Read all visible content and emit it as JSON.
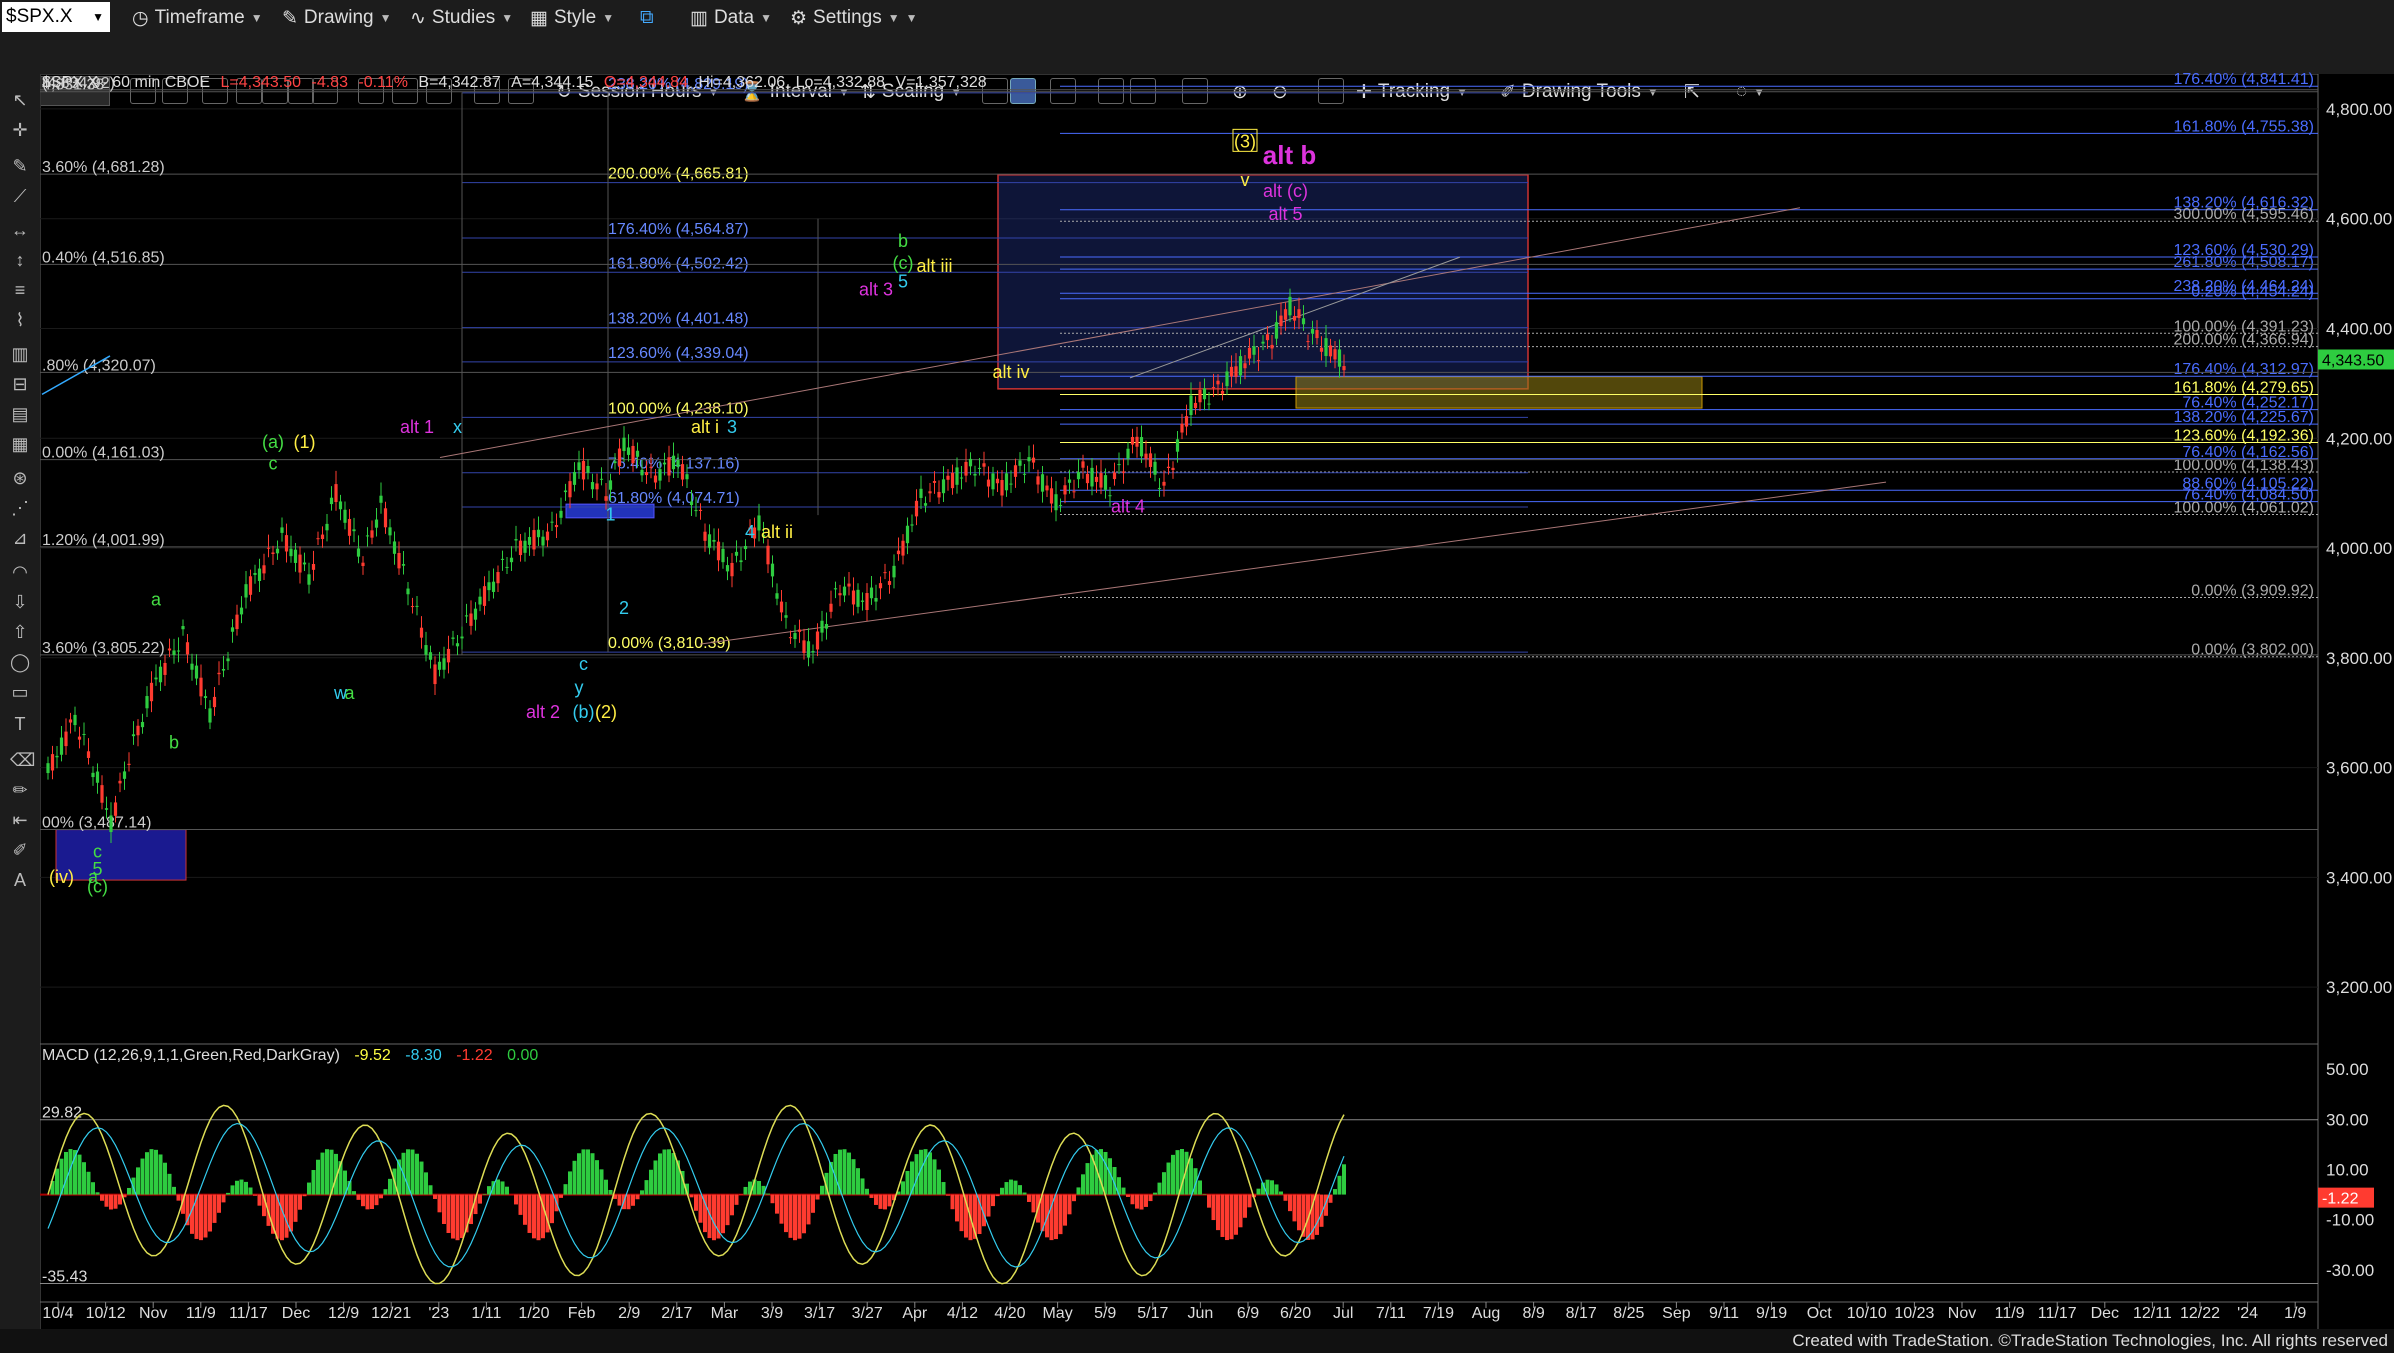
{
  "toolbar": {
    "symbol": "$SPX.X",
    "timeframe": "Timeframe",
    "drawing": "Drawing",
    "studies": "Studies",
    "style": "Style",
    "data": "Data",
    "settings": "Settings",
    "session_hours": "Session Hours",
    "interval": "Interval",
    "scaling": "Scaling",
    "tracking": "Tracking",
    "drawing_tools": "Drawing Tools"
  },
  "header": {
    "symbol_line": "$SPX.X - 60 min  CBOE",
    "last": "L=4,343.50",
    "change": "-4.83",
    "change_pct": "-0.11%",
    "bid": "B=4,342.87",
    "ask": "A=4,344.15",
    "open": "O=4,344.84",
    "high": "Hi=4,362.06",
    "low": "Lo=4,332.88",
    "volume": "V=1,357,328"
  },
  "colors": {
    "up": "#2ecc40",
    "down": "#ff3b30",
    "background": "#000000",
    "fib_blue": "#4a6cff",
    "fib_yellow": "#ffff66",
    "wave_green": "#44dd44",
    "wave_cyan": "#33ccee",
    "wave_magenta": "#dd33dd",
    "wave_yellow": "#ffee44"
  },
  "chart_data": [
    {
      "type": "candlestick",
      "title": "$SPX.X - 60 min",
      "x_ticks": [
        "10/4",
        "10/12",
        "Nov",
        "11/9",
        "11/17",
        "Dec",
        "12/9",
        "12/21",
        "'23",
        "1/11",
        "1/20",
        "Feb",
        "2/9",
        "2/17",
        "Mar",
        "3/9",
        "3/17",
        "3/27",
        "Apr",
        "4/12",
        "4/20",
        "May",
        "5/9",
        "5/17",
        "Jun",
        "6/9",
        "6/20",
        "Jul",
        "7/11",
        "7/19",
        "Aug",
        "8/9",
        "8/17",
        "8/25",
        "Sep",
        "9/11",
        "9/19",
        "Oct",
        "10/10",
        "10/23",
        "Nov",
        "11/9",
        "11/17",
        "Dec",
        "12/11",
        "12/22",
        "'24",
        "1/9"
      ],
      "y_ticks": [
        "4,800.00",
        "4,600.00",
        "4,400.00",
        "4,200.00",
        "4,000.00",
        "3,800.00",
        "3,600.00",
        "3,400.00",
        "3,200.00"
      ],
      "ylim": [
        3100,
        4860
      ],
      "last_price_label": "4,343.50",
      "price_path_x": [
        0,
        1,
        2,
        3,
        4,
        5,
        6,
        7,
        8,
        9,
        10,
        11,
        12,
        13,
        14,
        15,
        16,
        17,
        18,
        19,
        20,
        21,
        22,
        23,
        24,
        25,
        26,
        27,
        28,
        29,
        30,
        31,
        32,
        33,
        34,
        35,
        36,
        37,
        38,
        39,
        40,
        41,
        42,
        43,
        44,
        45,
        46,
        47,
        48,
        49,
        50,
        51,
        52,
        53,
        54,
        55,
        56,
        57,
        58,
        59,
        60,
        61,
        62,
        63,
        64,
        65,
        66,
        67,
        68,
        69,
        70,
        71,
        72,
        73,
        74,
        75,
        76,
        77,
        78,
        79,
        80,
        81,
        82,
        83,
        84,
        85,
        86,
        87,
        88,
        89,
        90,
        91,
        92,
        93,
        94,
        95,
        96,
        97,
        98,
        99,
        100,
        101,
        102,
        103,
        104,
        105,
        106,
        107,
        108,
        109,
        110,
        111,
        112,
        113,
        114,
        115,
        116,
        117,
        118,
        119,
        120,
        121,
        122,
        123,
        124,
        125,
        126,
        127,
        128,
        129,
        130,
        131,
        132,
        133,
        134,
        135,
        136,
        137,
        138,
        139,
        140,
        141,
        142,
        143,
        144,
        145,
        146,
        147,
        148,
        149,
        150,
        151,
        152,
        153,
        154,
        155,
        156,
        157,
        158,
        159,
        160,
        161,
        162,
        163,
        164,
        165,
        166,
        167,
        168,
        169,
        170,
        171,
        172,
        173,
        174,
        175,
        176,
        177,
        178,
        179,
        180,
        181,
        182,
        183,
        184,
        185,
        186,
        187,
        188,
        189,
        190,
        191,
        192,
        193,
        194,
        195,
        196,
        197,
        198,
        199,
        200,
        201,
        202,
        203,
        204,
        205,
        206,
        207,
        208,
        209,
        210,
        211,
        212,
        213,
        214,
        215,
        216,
        217,
        218,
        219,
        220,
        221,
        222,
        223,
        224,
        225,
        226,
        227,
        228,
        229,
        230,
        231,
        232,
        233,
        234,
        235,
        236,
        237,
        238,
        239,
        240,
        241,
        242,
        243,
        244,
        245,
        246,
        247,
        248,
        249,
        250,
        251,
        252,
        253,
        254,
        255,
        256,
        257,
        258,
        259,
        260,
        261,
        262,
        263,
        264,
        265,
        266,
        267,
        268,
        269,
        270,
        271,
        272,
        273,
        274,
        275,
        276,
        277,
        278,
        279,
        280,
        281,
        282,
        283,
        284,
        285,
        286,
        287,
        288,
        289,
        290,
        291,
        292,
        293,
        294,
        295,
        296,
        297,
        298,
        299,
        300,
        301,
        302,
        303,
        304,
        305,
        306,
        307,
        308,
        309,
        310,
        311,
        312,
        313,
        314,
        315,
        316,
        317,
        318,
        319,
        320,
        321,
        322,
        323,
        324,
        325,
        326,
        327,
        328,
        329,
        330,
        331,
        332,
        333,
        334,
        335,
        336,
        337,
        338,
        339,
        340,
        341,
        342,
        343,
        344,
        345,
        346,
        347,
        348,
        349,
        350
      ],
      "price_anchors": [
        [
          0,
          3590
        ],
        [
          6,
          3690
        ],
        [
          10,
          3600
        ],
        [
          14,
          3500
        ],
        [
          18,
          3620
        ],
        [
          24,
          3760
        ],
        [
          30,
          3840
        ],
        [
          36,
          3700
        ],
        [
          44,
          3920
        ],
        [
          52,
          4020
        ],
        [
          58,
          3950
        ],
        [
          64,
          4100
        ],
        [
          70,
          3980
        ],
        [
          74,
          4080
        ],
        [
          80,
          3930
        ],
        [
          86,
          3770
        ],
        [
          90,
          3820
        ],
        [
          96,
          3900
        ],
        [
          104,
          4000
        ],
        [
          112,
          4030
        ],
        [
          118,
          4150
        ],
        [
          124,
          4100
        ],
        [
          128,
          4190
        ],
        [
          134,
          4130
        ],
        [
          140,
          4160
        ],
        [
          146,
          4030
        ],
        [
          152,
          3960
        ],
        [
          158,
          4050
        ],
        [
          164,
          3860
        ],
        [
          170,
          3810
        ],
        [
          176,
          3930
        ],
        [
          182,
          3900
        ],
        [
          188,
          3960
        ],
        [
          194,
          4090
        ],
        [
          200,
          4120
        ],
        [
          206,
          4150
        ],
        [
          212,
          4110
        ],
        [
          218,
          4160
        ],
        [
          224,
          4080
        ],
        [
          230,
          4140
        ],
        [
          236,
          4110
        ],
        [
          242,
          4200
        ],
        [
          248,
          4110
        ],
        [
          254,
          4260
        ],
        [
          260,
          4290
        ],
        [
          266,
          4340
        ],
        [
          272,
          4380
        ],
        [
          276,
          4440
        ],
        [
          280,
          4395
        ],
        [
          286,
          4350
        ],
        [
          288,
          4340
        ]
      ],
      "price_series_note": "",
      "fib_labels_right": [
        {
          "text": "176.40% (4,841.41)",
          "value": 4841.41
        },
        {
          "text": "161.80% (4,755.38)",
          "value": 4755.38
        },
        {
          "text": "138.20% (4,616.32)",
          "value": 4616.32
        },
        {
          "text": "300.00% (4,595.46)",
          "value": 4595.46
        },
        {
          "text": "123.60% (4,530.29)",
          "value": 4530.29
        },
        {
          "text": "261.80% (4,508.17)",
          "value": 4508.17
        },
        {
          "text": "238.20% (4,464.24)",
          "value": 4464.24
        },
        {
          "text": "0.20% (4,454.24)",
          "value": 4454.24
        },
        {
          "text": "100.00% (4,391.23)",
          "value": 4391.23
        },
        {
          "text": "200.00% (4,366.94)",
          "value": 4366.94
        },
        {
          "text": "176.40% (4,312.97)",
          "value": 4312.97
        },
        {
          "text": "161.80% (4,279.65)",
          "value": 4279.65
        },
        {
          "text": "76.40% (4,252.17)",
          "value": 4252.17
        },
        {
          "text": "138.20% (4,225.67)",
          "value": 4225.67
        },
        {
          "text": "123.60% (4,192.36)",
          "value": 4192.36
        },
        {
          "text": "76.40% (4,162.56)",
          "value": 4162.56
        },
        {
          "text": "100.00% (4,138.43)",
          "value": 4138.43
        },
        {
          "text": "88.60% (4,105.22)",
          "value": 4105.22
        },
        {
          "text": "76.40% (4,084.50)",
          "value": 4084.5
        },
        {
          "text": "100.00% (4,061.02)",
          "value": 4061.02
        },
        {
          "text": "0.00% (3,909.92)",
          "value": 3909.92
        },
        {
          "text": "0.00% (3,802.00)",
          "value": 3802.0
        }
      ],
      "fib_labels_mid": [
        {
          "text": "238.20% (4,829.19)",
          "value": 4829.19
        },
        {
          "text": "200.00% (4,665.81)",
          "value": 4665.81
        },
        {
          "text": "176.40% (4,564.87)",
          "value": 4564.87
        },
        {
          "text": "161.80% (4,502.42)",
          "value": 4502.42
        },
        {
          "text": "138.20% (4,401.48)",
          "value": 4401.48
        },
        {
          "text": "123.60% (4,339.04)",
          "value": 4339.04
        },
        {
          "text": "100.00% (4,238.10)",
          "value": 4238.1
        },
        {
          "text": "76.40% (4,137.16)",
          "value": 4137.16
        },
        {
          "text": "61.80% (4,074.71)",
          "value": 4074.71
        },
        {
          "text": "0.00% (3,810.39)",
          "value": 3810.39
        }
      ],
      "fib_labels_left": [
        {
          "text": "4,831.38",
          "value": 4831.38
        },
        {
          "text": "(4,834.92)",
          "value": 4834.92
        },
        {
          "text": "3.60% (4,681.28)",
          "value": 4681.28
        },
        {
          "text": "0.40% (4,516.85)",
          "value": 4516.85
        },
        {
          "text": ".80% (4,320.07)",
          "value": 4320.07
        },
        {
          "text": "0.00% (4,161.03)",
          "value": 4161.03
        },
        {
          "text": "1.20% (4,001.99)",
          "value": 4001.99
        },
        {
          "text": "3.60% (3,805.22)",
          "value": 3805.22
        },
        {
          "text": "00% (3,487.14)",
          "value": 3487.14
        }
      ],
      "wave_labels": [
        {
          "text": "(iv)",
          "color": "wave_yellow",
          "xi": 3,
          "y": 3390
        },
        {
          "text": "a",
          "color": "wave_green",
          "xi": 10,
          "y": 3390
        },
        {
          "text": "c",
          "color": "wave_green",
          "xi": 11,
          "y": 3436
        },
        {
          "text": "5",
          "color": "wave_green",
          "xi": 11,
          "y": 3404
        },
        {
          "text": "(c)",
          "color": "wave_green",
          "xi": 11,
          "y": 3372
        },
        {
          "text": "a",
          "color": "wave_green",
          "xi": 24,
          "y": 3895
        },
        {
          "text": "b",
          "color": "wave_green",
          "xi": 28,
          "y": 3635
        },
        {
          "text": "(a)",
          "color": "wave_green",
          "xi": 50,
          "y": 4182
        },
        {
          "text": "c",
          "color": "wave_green",
          "xi": 50,
          "y": 4143
        },
        {
          "text": "(1)",
          "color": "wave_yellow",
          "xi": 57,
          "y": 4182
        },
        {
          "text": "w",
          "color": "wave_cyan",
          "xi": 65,
          "y": 3725
        },
        {
          "text": "a",
          "color": "wave_green",
          "xi": 67,
          "y": 3725
        },
        {
          "text": "alt 1",
          "color": "wave_magenta",
          "xi": 82,
          "y": 4210
        },
        {
          "text": "x",
          "color": "wave_cyan",
          "xi": 91,
          "y": 4210
        },
        {
          "text": "alt 2",
          "color": "wave_magenta",
          "xi": 110,
          "y": 3690
        },
        {
          "text": "(b)",
          "color": "wave_cyan",
          "xi": 119,
          "y": 3690
        },
        {
          "text": "(2)",
          "color": "wave_yellow",
          "xi": 124,
          "y": 3690
        },
        {
          "text": "y",
          "color": "wave_cyan",
          "xi": 118,
          "y": 3735
        },
        {
          "text": "c",
          "color": "wave_cyan",
          "xi": 119,
          "y": 3778
        },
        {
          "text": "1",
          "color": "wave_cyan",
          "xi": 125,
          "y": 4050
        },
        {
          "text": "2",
          "color": "wave_cyan",
          "xi": 128,
          "y": 3880
        },
        {
          "text": "alt i",
          "color": "wave_yellow",
          "xi": 146,
          "y": 4210
        },
        {
          "text": "3",
          "color": "wave_cyan",
          "xi": 152,
          "y": 4210
        },
        {
          "text": "4",
          "color": "wave_cyan",
          "xi": 156,
          "y": 4018
        },
        {
          "text": "alt ii",
          "color": "wave_yellow",
          "xi": 162,
          "y": 4018
        },
        {
          "text": "alt 3",
          "color": "wave_magenta",
          "xi": 184,
          "y": 4460
        },
        {
          "text": "5",
          "color": "wave_cyan",
          "xi": 190,
          "y": 4475
        },
        {
          "text": "(c)",
          "color": "wave_green",
          "xi": 190,
          "y": 4508
        },
        {
          "text": "b",
          "color": "wave_green",
          "xi": 190,
          "y": 4548
        },
        {
          "text": "alt iii",
          "color": "wave_yellow",
          "xi": 197,
          "y": 4503
        },
        {
          "text": "alt iv",
          "color": "wave_yellow",
          "xi": 214,
          "y": 4310
        },
        {
          "text": "alt 4",
          "color": "wave_magenta",
          "xi": 240,
          "y": 4065
        },
        {
          "text": "v",
          "color": "wave_yellow",
          "xi": 266,
          "y": 4660
        },
        {
          "text": "alt (c)",
          "color": "wave_magenta",
          "xi": 275,
          "y": 4640
        },
        {
          "text": "alt 5",
          "color": "wave_magenta",
          "xi": 275,
          "y": 4598
        }
      ],
      "boxed_label": {
        "text": "(3)",
        "xi": 266,
        "y": 4730
      },
      "big_label": {
        "text": "alt b",
        "xi": 275,
        "y": 4700
      }
    },
    {
      "type": "line",
      "title": "MACD (12,26,9,1,1,Green,Red,DarkGray)",
      "series_values": [
        "-9.52",
        "-8.30",
        "-1.22",
        "0.00"
      ],
      "y_ticks": [
        "50.00",
        "30.00",
        "10.00",
        "-10.00",
        "-30.00"
      ],
      "ylim": [
        -42,
        56
      ],
      "level_labels": [
        {
          "text": "29.82",
          "value": 29.82
        },
        {
          "text": "-35.43",
          "value": -35.43
        }
      ],
      "last_label": "-1.22"
    }
  ],
  "footer": {
    "text": "Created with TradeStation. ©TradeStation Technologies, Inc. All rights reserved"
  }
}
